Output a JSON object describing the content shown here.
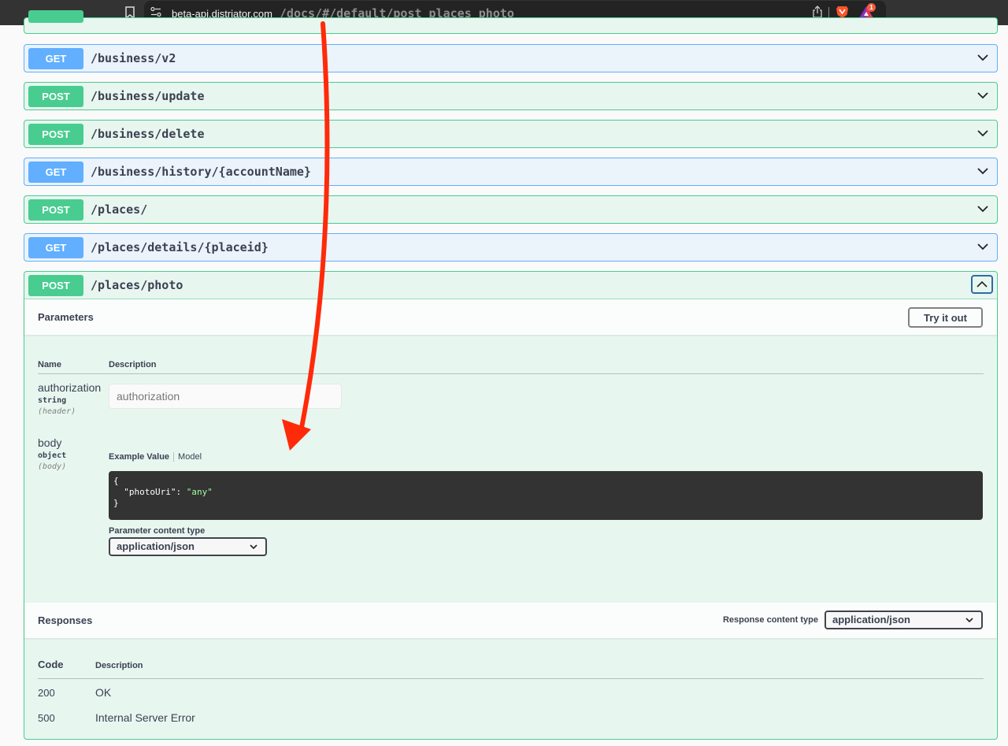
{
  "browser": {
    "url_host": "beta-api.distriator.com",
    "url_path": "/docs/#/default/post_places_photo",
    "rewards_badge_count": "1"
  },
  "operations": [
    {
      "method": "GET",
      "path": "/business/v2",
      "expanded": false
    },
    {
      "method": "POST",
      "path": "/business/update",
      "expanded": false
    },
    {
      "method": "POST",
      "path": "/business/delete",
      "expanded": false
    },
    {
      "method": "GET",
      "path": "/business/history/{accountName}",
      "expanded": false
    },
    {
      "method": "POST",
      "path": "/places/",
      "expanded": false
    },
    {
      "method": "GET",
      "path": "/places/details/{placeid}",
      "expanded": false
    },
    {
      "method": "POST",
      "path": "/places/photo",
      "expanded": true
    }
  ],
  "expanded_op": {
    "parameters_title": "Parameters",
    "try_it_out_label": "Try it out",
    "table_headers": {
      "name": "Name",
      "description": "Description"
    },
    "params": [
      {
        "name": "authorization",
        "type": "string",
        "in": "(header)",
        "placeholder": "authorization"
      },
      {
        "name": "body",
        "type": "object",
        "in": "(body)"
      }
    ],
    "body_tabs": {
      "example": "Example Value",
      "model": "Model"
    },
    "example_code": {
      "open": "{",
      "key": "\"photoUri\"",
      "colon": ": ",
      "value": "\"any\"",
      "close": "}"
    },
    "parameter_content_type_label": "Parameter content type",
    "parameter_content_type": "application/json",
    "responses_title": "Responses",
    "response_content_type_label": "Response content type",
    "response_content_type": "application/json",
    "response_headers": {
      "code": "Code",
      "description": "Description"
    },
    "responses": [
      {
        "code": "200",
        "description": "OK"
      },
      {
        "code": "500",
        "description": "Internal Server Error"
      }
    ]
  },
  "colors": {
    "get": "#61affe",
    "post": "#49cc90",
    "annotation_arrow": "#ff2a0a"
  }
}
